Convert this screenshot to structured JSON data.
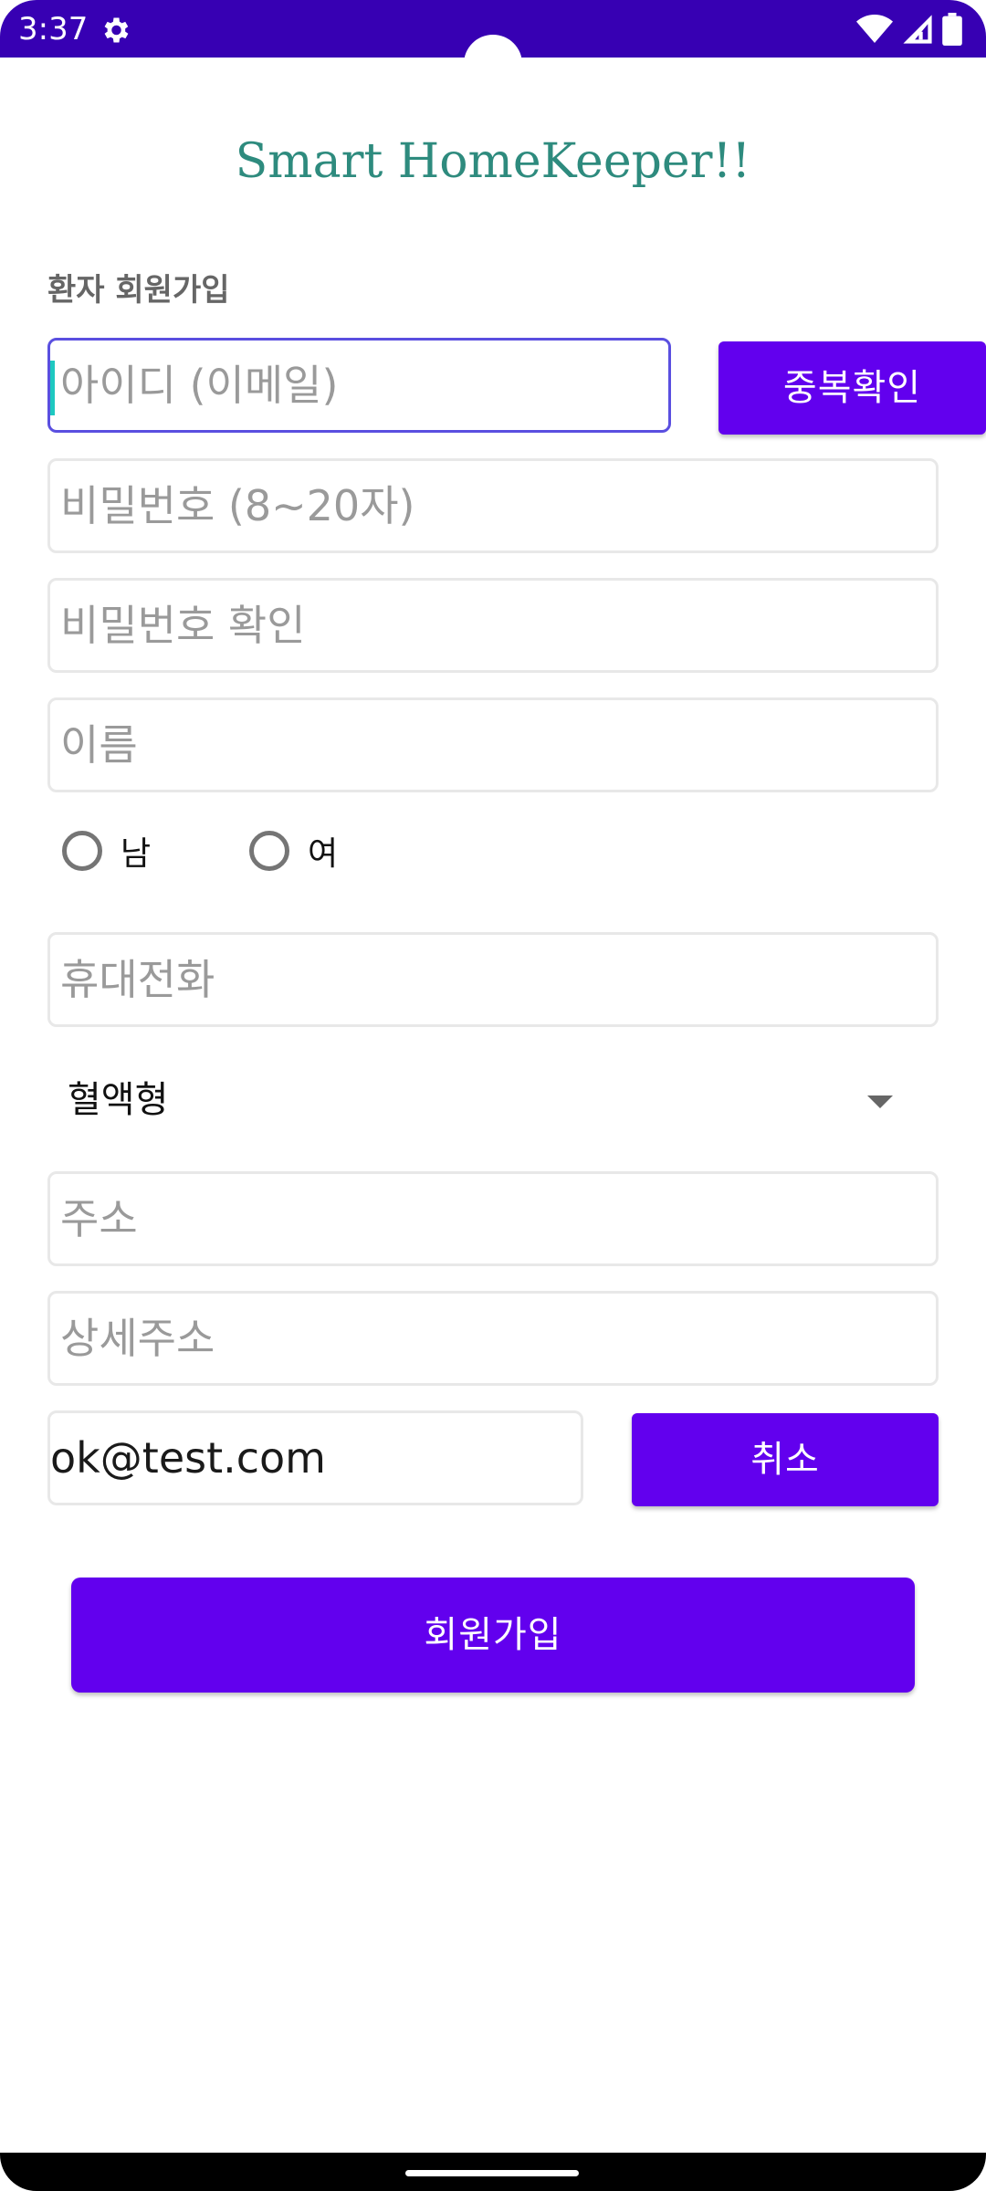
{
  "status_bar": {
    "time": "3:37",
    "icons": [
      "gear-icon",
      "wifi-icon",
      "signal-icon",
      "battery-icon"
    ],
    "color": "#3700B3"
  },
  "app": {
    "title": "Smart HomeKeeper!!",
    "title_color": "#2E8B7E"
  },
  "form": {
    "section_label": "환자 회원가입",
    "id_placeholder": "아이디 (이메일)",
    "check_duplicate_label": "중복확인",
    "password_placeholder": "비밀번호 (8~20자)",
    "password_confirm_placeholder": "비밀번호 확인",
    "name_placeholder": "이름",
    "gender": {
      "male_label": "남",
      "female_label": "여"
    },
    "phone_placeholder": "휴대전화",
    "blood_type_selected": "혈액형",
    "address_placeholder": "주소",
    "address_detail_placeholder": "상세주소",
    "email_value": "ok@test.com",
    "cancel_label": "취소",
    "signup_label": "회원가입"
  },
  "colors": {
    "accent": "#6200EE",
    "focus_border": "#5a4fe0",
    "caret": "#1ec8c0"
  }
}
